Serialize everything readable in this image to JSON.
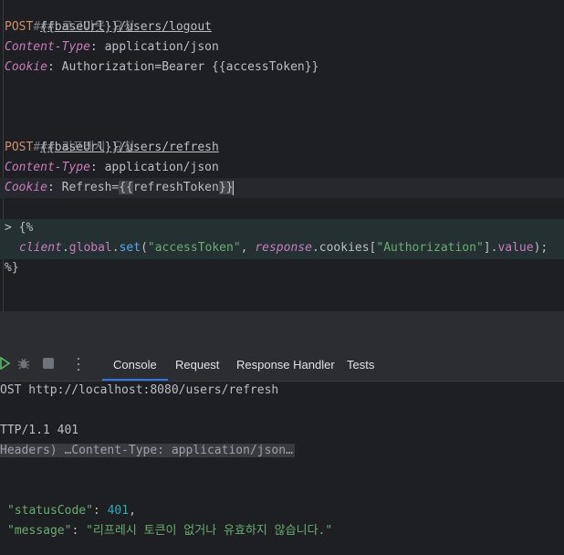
{
  "editor": {
    "req1": {
      "comment": "### 로그아웃 요청",
      "method": "POST",
      "url_prefix": "{{",
      "url_var": "baseUrl",
      "url_suffix": "}}/users/logout",
      "h1_key": "Content-Type",
      "h1_val": ": application/json",
      "h2_key": "Cookie",
      "h2_val": ": Authorization=Bearer {{accessToken}}"
    },
    "req2": {
      "comment": "### 리프레시 요청",
      "method": "POST",
      "url_prefix": "{{",
      "url_var": "baseUrl",
      "url_suffix": "}}/users/refresh",
      "h1_key": "Content-Type",
      "h1_val": ": application/json",
      "h2_key": "Cookie",
      "h2_val_pre": ": Refresh=",
      "h2_brace_open": "{{",
      "h2_var": "refreshToken",
      "h2_brace_close": "}}"
    },
    "script": {
      "open": "> {%",
      "obj": "client",
      "dot1": ".",
      "global": "global",
      "dot2": ".",
      "fn": "set",
      "paren_open": "(",
      "arg1": "\"accessToken\"",
      "comma": ", ",
      "resp": "response",
      "cookies": ".cookies[",
      "arg2": "\"Authorization\"",
      "tail": "].",
      "value": "value",
      "end": ");",
      "close": "%}"
    }
  },
  "toolbar": {
    "icons": [
      "run-icon",
      "debug-icon",
      "stop-icon",
      "more-vertical-icon"
    ],
    "tabs": [
      "Console",
      "Request",
      "Response Handler",
      "Tests"
    ],
    "active_tab": "Console"
  },
  "console": {
    "request_line": "OST http://localhost:8080/users/refresh",
    "status_line": "TTP/1.1 401",
    "headers_collapsed": "Headers) …Content-Type: application/json…",
    "json": {
      "statusCode_key": "\"statusCode\"",
      "statusCode_sep": ": ",
      "statusCode_val": "401",
      "statusCode_comma": ",",
      "message_key": "\"message\"",
      "message_sep": ": ",
      "message_val": "\"리프레시 토큰이 없거나 유효하지 않습니다.\""
    }
  },
  "colors": {
    "editor_bg": "#1e1f22",
    "panel_bg": "#2b2d30",
    "accent": "#3574f0",
    "run_green": "#5fb865"
  }
}
